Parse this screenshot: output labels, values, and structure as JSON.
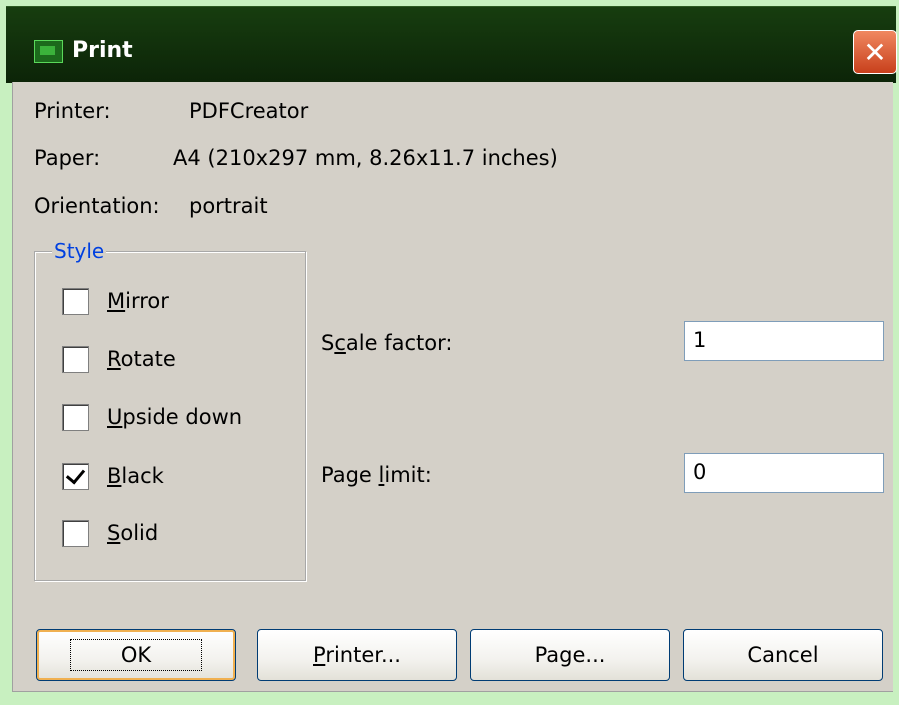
{
  "window": {
    "title": "Print",
    "close_glyph": "✕",
    "icon": "print-app-icon"
  },
  "info": {
    "printer_label": "Printer:",
    "printer_value": "PDFCreator",
    "paper_label": "Paper:",
    "paper_value": "A4 (210x297 mm, 8.26x11.7 inches)",
    "orientation_label": "Orientation:",
    "orientation_value": "portrait"
  },
  "style_group": {
    "title": "Style",
    "options": [
      {
        "key": "M",
        "rest": "irror",
        "checked": false
      },
      {
        "key": "R",
        "rest": "otate",
        "checked": false
      },
      {
        "key": "U",
        "rest": "pside down",
        "checked": false
      },
      {
        "key": "B",
        "rest": "lack",
        "checked": true
      },
      {
        "key": "S",
        "rest": "olid",
        "checked": false
      }
    ]
  },
  "scale": {
    "label_pre": "S",
    "label_key": "c",
    "label_post": "ale factor:",
    "value": "1"
  },
  "page_limit": {
    "label_pre": "Page ",
    "label_key": "l",
    "label_post": "imit:",
    "value": "0"
  },
  "buttons": {
    "ok": "OK",
    "printer_key": "P",
    "printer_rest": "rinter...",
    "page": "Page...",
    "cancel": "Cancel"
  },
  "colors": {
    "titlebar": "#0c2408",
    "dialog_bg": "#d4d0c8",
    "group_title": "#0040e0",
    "close_button": "#c8401c"
  }
}
